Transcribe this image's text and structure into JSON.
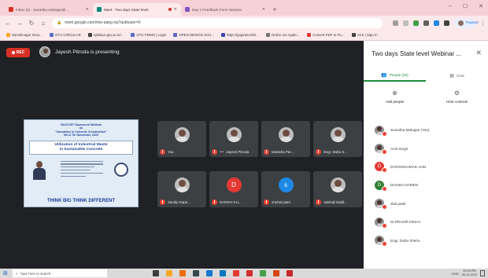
{
  "browser": {
    "tabs": [
      {
        "title": "Inbox (3) - sumetha.mahajan@...",
        "active": false,
        "favicon_color": "#d93025",
        "recording": false
      },
      {
        "title": "Meet - Two days State level",
        "active": true,
        "favicon_color": "#00897b",
        "recording": true
      },
      {
        "title": "Day 1 Feedback Form Session",
        "active": false,
        "favicon_color": "#7e57c2",
        "recording": false
      }
    ],
    "new_tab": "+",
    "window_controls": {
      "minimize": "–",
      "maximize": "☐",
      "close": "✕"
    },
    "nav": {
      "back": "←",
      "forward": "→",
      "reload": "↻",
      "home": "⌂"
    },
    "url": "meet.google.com/mie-aaeg-ssj?authuser=0",
    "profile_label": "Paused",
    "bookmarks": [
      {
        "label": "Zanshinagar Instu...",
        "color": "#f9a825"
      },
      {
        "label": "GTU CIRCULAR",
        "color": "#5c6bc0"
      },
      {
        "label": "syllabus.gtu.ac.in/...",
        "color": "#424242"
      },
      {
        "label": "GTU PMMS | Login",
        "color": "#5c6bc0"
      },
      {
        "label": "OPEN DESIGN SCH...",
        "color": "#5c6bc0"
      },
      {
        "label": "https://gujaratcmfel...",
        "color": "#3949ab"
      },
      {
        "label": "Online Ice Applic...",
        "color": "#757575"
      },
      {
        "label": "Convert PDF to Po...",
        "color": "#e53935"
      },
      {
        "label": "AKS | Sign In",
        "color": "#424242"
      }
    ]
  },
  "meet": {
    "rec_label": "REC",
    "presenter_text": "Jayesh Pitroda is presenting",
    "slide": {
      "header": "GUJCOST Sponsored Webinar\non\n\"Innovation in Concrete Construction\"\n6th & 7th November, 2020",
      "title": "Utilization of Industrial Waste\nin Sustainable Concrete",
      "tagline": "THINK BIG THINK DIFFERENT"
    },
    "tiles": [
      {
        "name": "You",
        "kind": "photo",
        "dots": false
      },
      {
        "name": "Jayesh Pitroda",
        "kind": "photo",
        "dots": true
      },
      {
        "name": "Manisha Par...",
        "kind": "photo",
        "dots": false
      },
      {
        "name": "Engr. Daha S...",
        "kind": "photo",
        "dots": false
      },
      {
        "name": "Sandip Kapa...",
        "kind": "photo",
        "dots": false
      },
      {
        "name": "DARSHI KU...",
        "kind": "letter",
        "letter": "D",
        "color": "#e53935",
        "dots": false
      },
      {
        "name": "snehal patel",
        "kind": "letter",
        "letter": "s",
        "color": "#1e88e5",
        "dots": false
      },
      {
        "name": "Vaishali Baldi...",
        "kind": "photo",
        "dots": false
      }
    ]
  },
  "panel": {
    "title": "Two days State level Webinar ...",
    "close": "✕",
    "tabs": [
      {
        "label": "People (33)",
        "icon": "👥",
        "active": true
      },
      {
        "label": "Chat",
        "icon": "▤",
        "active": false
      }
    ],
    "actions": [
      {
        "label": "Add people",
        "icon": "⊕"
      },
      {
        "label": "Host controls",
        "icon": "⚙"
      }
    ],
    "people": [
      {
        "name": "Sumetha Mahajan (You)",
        "kind": "photo"
      },
      {
        "name": "Amit Singh",
        "kind": "photo"
      },
      {
        "name": "DARSHIKUMAR JAIN",
        "kind": "letter",
        "letter": "D",
        "color": "#e53935"
      },
      {
        "name": "DHAIDA NAMEN",
        "kind": "letter",
        "letter": "D",
        "color": "#2e7d32"
      },
      {
        "name": "dixit patel",
        "kind": "photo"
      },
      {
        "name": "Dr.PRADIP DESAI",
        "kind": "photo"
      },
      {
        "name": "Engr. Daha Shehu",
        "kind": "photo"
      }
    ]
  },
  "taskbar": {
    "start_icon": "⊞",
    "search_placeholder": "Type here to search",
    "apps": [
      "#3c3c3c",
      "#f9a825",
      "#ef6c00",
      "#37474f",
      "#1976d2",
      "#0277bd",
      "#e53935",
      "#d32f2f",
      "#43a047",
      "#d84315",
      "#c62828"
    ],
    "tray_lang": "ENG",
    "time": "03:03 PM",
    "date": "06-11-2020"
  }
}
